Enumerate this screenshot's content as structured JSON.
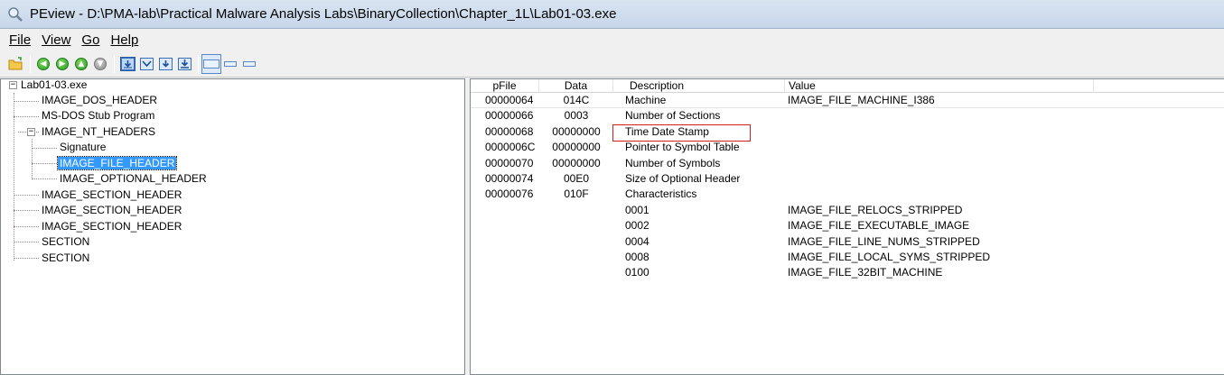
{
  "window": {
    "title": "PEview - D:\\PMA-lab\\Practical Malware Analysis Labs\\BinaryCollection\\Chapter_1L\\Lab01-03.exe",
    "app_icon": "magnifier-icon"
  },
  "menu": {
    "file": "File",
    "view": "View",
    "go": "Go",
    "help": "Help"
  },
  "toolbar": {
    "buttons": [
      "open-icon",
      "back-icon",
      "forward-icon",
      "previous-icon",
      "next-icon",
      "view-byte-icon",
      "view-word-icon",
      "view-dword-icon",
      "view-qword-icon",
      "list-view-icon",
      "small-view-icon",
      "tiny-view-icon"
    ]
  },
  "tree": {
    "root": "Lab01-03.exe",
    "items": [
      "IMAGE_DOS_HEADER",
      "MS-DOS Stub Program",
      "IMAGE_NT_HEADERS",
      "Signature",
      "IMAGE_FILE_HEADER",
      "IMAGE_OPTIONAL_HEADER",
      "IMAGE_SECTION_HEADER",
      "IMAGE_SECTION_HEADER",
      "IMAGE_SECTION_HEADER",
      "SECTION",
      "SECTION"
    ],
    "selected": "IMAGE_FILE_HEADER"
  },
  "list": {
    "columns": [
      "pFile",
      "Data",
      "Description",
      "Value"
    ],
    "rows": [
      {
        "pfile": "00000064",
        "data": "014C",
        "description": "Machine",
        "value": "IMAGE_FILE_MACHINE_I386"
      },
      {
        "pfile": "00000066",
        "data": "0003",
        "description": "Number of Sections",
        "value": ""
      },
      {
        "pfile": "00000068",
        "data": "00000000",
        "description": "Time Date Stamp",
        "value": ""
      },
      {
        "pfile": "0000006C",
        "data": "00000000",
        "description": "Pointer to Symbol Table",
        "value": ""
      },
      {
        "pfile": "00000070",
        "data": "00000000",
        "description": "Number of Symbols",
        "value": ""
      },
      {
        "pfile": "00000074",
        "data": "00E0",
        "description": "Size of Optional Header",
        "value": ""
      },
      {
        "pfile": "00000076",
        "data": "010F",
        "description": "Characteristics",
        "value": ""
      },
      {
        "pfile": "",
        "data": "",
        "description": "0001",
        "value": "IMAGE_FILE_RELOCS_STRIPPED"
      },
      {
        "pfile": "",
        "data": "",
        "description": "0002",
        "value": "IMAGE_FILE_EXECUTABLE_IMAGE"
      },
      {
        "pfile": "",
        "data": "",
        "description": "0004",
        "value": "IMAGE_FILE_LINE_NUMS_STRIPPED"
      },
      {
        "pfile": "",
        "data": "",
        "description": "0008",
        "value": "IMAGE_FILE_LOCAL_SYMS_STRIPPED"
      },
      {
        "pfile": "",
        "data": "",
        "description": "0100",
        "value": "IMAGE_FILE_32BIT_MACHINE"
      }
    ],
    "highlighted_row": "Time Date Stamp",
    "highlight_color": "#d11f1f"
  },
  "colors": {
    "selection": "#3399ff",
    "toolbar_green": "#2a9d2a"
  }
}
